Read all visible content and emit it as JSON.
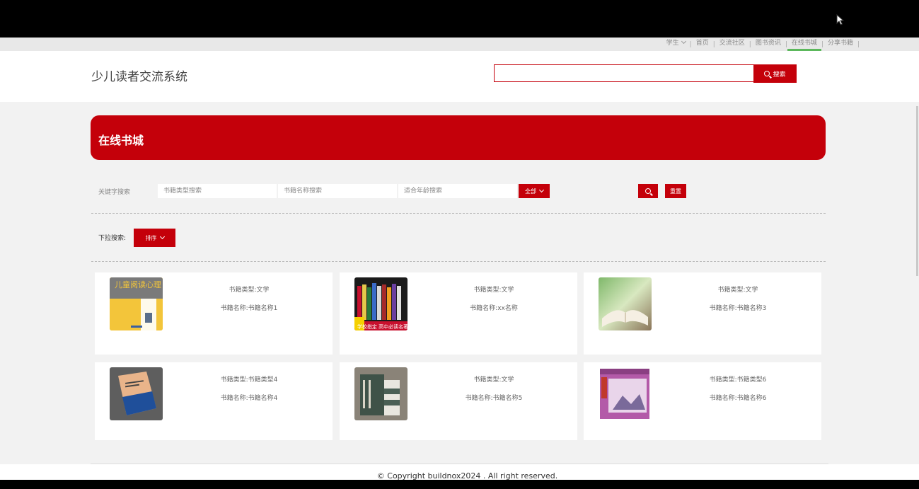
{
  "topnav": {
    "user": "学生",
    "items": [
      "首页",
      "交流社区",
      "图书资讯",
      "在线书城",
      "分享书籍"
    ],
    "active_index": 3
  },
  "header": {
    "title": "少儿读者交流系统",
    "search_value": "",
    "search_button": "搜索"
  },
  "banner": {
    "title": "在线书城"
  },
  "filters": {
    "keyword_label": "关键字搜索",
    "type_placeholder": "书籍类型搜索",
    "name_placeholder": "书籍名称搜索",
    "age_placeholder": "适合年龄搜索",
    "all_button": "全部",
    "reset_button": "重置",
    "dropdown_label": "下拉搜索:",
    "sort_button": "排序"
  },
  "books": [
    {
      "type": "书籍类型:文学",
      "name": "书籍名称:书籍名称1",
      "cover_text": "儿童阅读心理"
    },
    {
      "type": "书籍类型:文学",
      "name": "书籍名称:xx名称",
      "cover_text": "学校指定 高中必读名著"
    },
    {
      "type": "书籍类型:文学",
      "name": "书籍名称:书籍名称3",
      "cover_text": ""
    },
    {
      "type": "书籍类型:书籍类型4",
      "name": "书籍名称:书籍名称4",
      "cover_text": ""
    },
    {
      "type": "书籍类型:文学",
      "name": "书籍名称:书籍名称5",
      "cover_text": ""
    },
    {
      "type": "书籍类型:书籍类型6",
      "name": "书籍名称:书籍名称6",
      "cover_text": ""
    }
  ],
  "footer": {
    "copyright": "© Copyright buildnox2024 . All right reserved."
  },
  "colors": {
    "brand": "#c4000a",
    "active_underline": "#5cb85c",
    "page_bg": "#f2f2f2"
  }
}
